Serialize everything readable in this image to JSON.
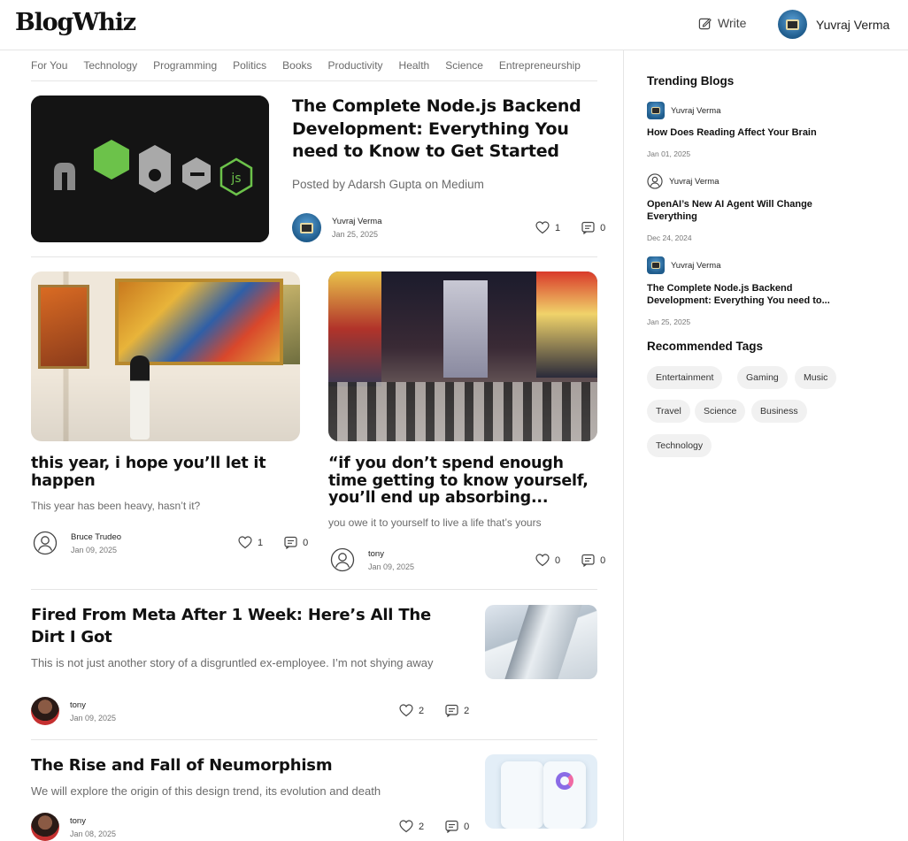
{
  "app": {
    "logo": "BlogWhiz"
  },
  "header": {
    "write_label": "Write",
    "user_name": "Yuvraj Verma"
  },
  "categories": [
    "For You",
    "Technology",
    "Programming",
    "Politics",
    "Books",
    "Productivity",
    "Health",
    "Science",
    "Entrepreneurship"
  ],
  "featured": {
    "title": "The Complete Node.js Backend Development: Everything You need to Know to Get Started",
    "subtitle": "Posted by Adarsh Gupta on Medium",
    "author": "Yuvraj Verma",
    "date": "Jan 25, 2025",
    "likes": "1",
    "comments": "0",
    "image_word": "node"
  },
  "grid_posts": [
    {
      "title": "this year, i hope you’ll let it happen",
      "subtitle": "This year has been heavy, hasn’t it?",
      "author": "Bruce Trudeo",
      "date": "Jan 09, 2025",
      "likes": "1",
      "comments": "0"
    },
    {
      "title": "“if you don’t spend enough time getting to know yourself, you’ll end up absorbing...",
      "subtitle": "you owe it to yourself to live a life that’s yours",
      "author": "tony",
      "date": "Jan 09, 2025",
      "likes": "0",
      "comments": "0"
    }
  ],
  "list_posts": [
    {
      "title": "Fired From Meta After 1 Week: Here’s All The Dirt I Got",
      "subtitle": "This is not just another story of a disgruntled ex-employee. I’m not shying away",
      "author": "tony",
      "date": "Jan 09, 2025",
      "likes": "2",
      "comments": "2"
    },
    {
      "title": "The Rise and Fall of Neumorphism",
      "subtitle": "We will explore the origin of this design trend, its evolution and death",
      "author": "tony",
      "date": "Jan 08, 2025",
      "likes": "2",
      "comments": "0"
    }
  ],
  "sidebar": {
    "trending_heading": "Trending Blogs",
    "trending": [
      {
        "author": "Yuvraj Verma",
        "title": "How Does Reading Affect Your Brain",
        "date": "Jan 01, 2025"
      },
      {
        "author": "Yuvraj Verma",
        "title": "OpenAI’s New AI Agent Will Change Everything",
        "date": "Dec 24, 2024"
      },
      {
        "author": "Yuvraj Verma",
        "title": "The Complete Node.js Backend Development: Everything You need to...",
        "date": "Jan 25, 2025"
      }
    ],
    "tags_heading": "Recommended Tags",
    "tags": [
      "Entertainment",
      "Gaming",
      "Music",
      "Travel",
      "Science",
      "Business",
      "Technology"
    ]
  },
  "icons": [
    "edit-icon",
    "heart-icon",
    "comment-icon",
    "user-outline-icon"
  ]
}
